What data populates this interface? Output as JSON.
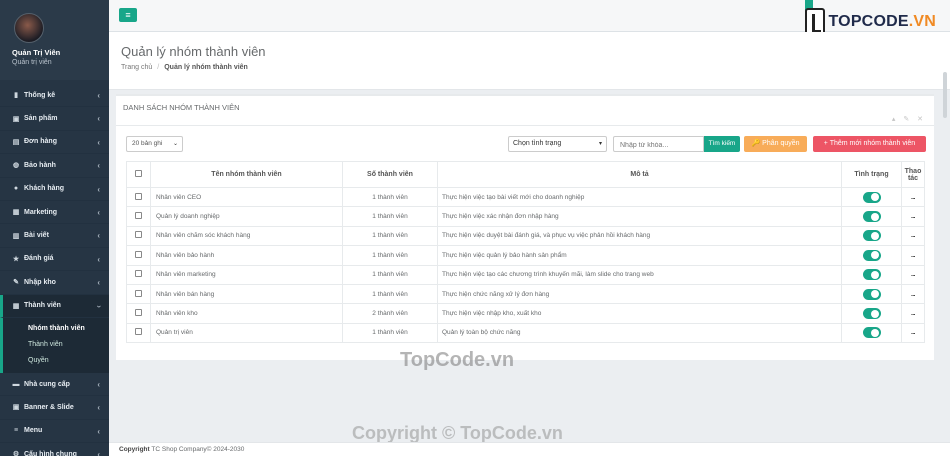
{
  "profile": {
    "name": "Quản Trị Viên",
    "role": "Quản trị viên"
  },
  "sidebar": {
    "items": [
      {
        "label": "Thống kê",
        "icon": "dashboard-icon",
        "glyph": "▮"
      },
      {
        "label": "Sản phẩm",
        "icon": "shopping-bag-icon",
        "glyph": "▣"
      },
      {
        "label": "Đơn hàng",
        "icon": "briefcase-icon",
        "glyph": "▤"
      },
      {
        "label": "Bảo hành",
        "icon": "shield-icon",
        "glyph": "◍"
      },
      {
        "label": "Khách hàng",
        "icon": "user-icon",
        "glyph": "●"
      },
      {
        "label": "Marketing",
        "icon": "megaphone-icon",
        "glyph": "▦"
      },
      {
        "label": "Bài viết",
        "icon": "file-text-icon",
        "glyph": "▥"
      },
      {
        "label": "Đánh giá",
        "icon": "star-icon",
        "glyph": "★"
      },
      {
        "label": "Nhập kho",
        "icon": "edit-icon",
        "glyph": "✎"
      },
      {
        "label": "Thành viên",
        "icon": "users-icon",
        "glyph": "▦"
      }
    ],
    "sub_items": [
      "Nhóm thành viên",
      "Thành viên",
      "Quyền"
    ],
    "items_after": [
      {
        "label": "Nhà cung cấp",
        "icon": "truck-icon",
        "glyph": "▬"
      },
      {
        "label": "Banner & Slide",
        "icon": "image-icon",
        "glyph": "▣"
      },
      {
        "label": "Menu",
        "icon": "menu-icon",
        "glyph": "≡"
      },
      {
        "label": "Cấu hình chung",
        "icon": "gear-icon",
        "glyph": "⚙"
      }
    ]
  },
  "topbar": {
    "menu_icon": "≡",
    "logo_main": "TOPCODE",
    "logo_tld": ".VN"
  },
  "header": {
    "title": "Quản lý nhóm thành viên",
    "breadcrumb_home": "Trang chủ",
    "breadcrumb_current": "Quản lý nhóm thành viên"
  },
  "panel": {
    "title": "DANH SÁCH NHÓM THÀNH VIÊN",
    "tools": "▴ ✎ ✕"
  },
  "controls": {
    "page_size": "20 bản ghi",
    "status_select": "Chọn tình trạng",
    "keyword_placeholder": "Nhập từ khóa...",
    "search_label": "Tìm kiếm",
    "permission_label": "🔑 Phân quyền",
    "add_label": "+ Thêm mới nhóm thành viên"
  },
  "table": {
    "headers": {
      "name": "Tên nhóm thành viên",
      "count": "Số thành viên",
      "desc": "Mô tả",
      "status": "Tình trạng",
      "action": "Thao tác"
    },
    "rows": [
      {
        "name": "Nhân viên CEO",
        "count": "1 thành viên",
        "desc": "Thực hiện việc tạo bài viết mới cho doanh nghiệp",
        "status": "on",
        "action": "..."
      },
      {
        "name": "Quản lý doanh nghiệp",
        "count": "1 thành viên",
        "desc": "Thực hiện việc xác nhận đơn nhập hàng",
        "status": "on",
        "action": "..."
      },
      {
        "name": "Nhân viên chăm sóc khách hàng",
        "count": "1 thành viên",
        "desc": "Thực hiện việc duyệt bài đánh giá, và phục vụ việc phản hồi khách hàng",
        "status": "on",
        "action": "..."
      },
      {
        "name": "Nhân viên bảo hành",
        "count": "1 thành viên",
        "desc": "Thực hiện việc quản lý bảo hành sản phẩm",
        "status": "on",
        "action": "..."
      },
      {
        "name": "Nhân viên marketing",
        "count": "1 thành viên",
        "desc": "Thực hiện việc tạo các chương trình khuyến mãi, làm slide cho trang web",
        "status": "on",
        "action": "..."
      },
      {
        "name": "Nhân viên bán hàng",
        "count": "1 thành viên",
        "desc": "Thực hiện chức năng xử lý đơn hàng",
        "status": "on",
        "action": "..."
      },
      {
        "name": "Nhân viên kho",
        "count": "2 thành viên",
        "desc": "Thực hiện việc nhập kho, xuất kho",
        "status": "on",
        "action": "..."
      },
      {
        "name": "Quản trị viên",
        "count": "1 thành viên",
        "desc": "Quản lý toàn bộ chức năng",
        "status": "on",
        "action": "..."
      }
    ]
  },
  "watermarks": {
    "center": "TopCode.vn",
    "bottom": "Copyright © TopCode.vn"
  },
  "footer": {
    "brand": "Copyright",
    "text": "TC Shop Company© 2024-2030"
  },
  "colors": {
    "accent": "#18a689",
    "sidebar": "#263544",
    "warning": "#f8ac59",
    "danger": "#ed5565"
  }
}
